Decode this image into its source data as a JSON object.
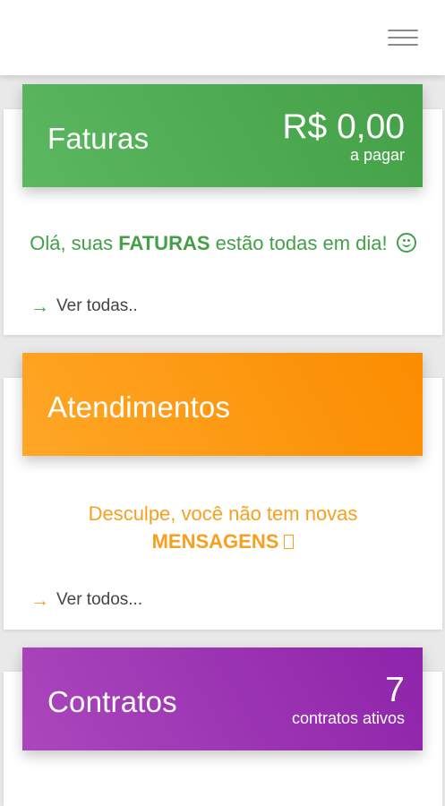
{
  "header": {
    "menu_icon": "hamburger-menu-icon"
  },
  "faturas": {
    "title": "Faturas",
    "amount": "R$ 0,00",
    "amount_label": "a pagar",
    "message_prefix": "Olá, suas ",
    "message_highlight": "FATURAS",
    "message_suffix": " estão todas em dia!",
    "message_icon": "smile-icon",
    "link": "Ver todas..",
    "colors": {
      "header_start": "#5cb860",
      "header_end": "#43a047",
      "text": "#43a047"
    }
  },
  "atendimentos": {
    "title": "Atendimentos",
    "message_line1": "Desculpe, você não tem novas",
    "message_highlight": "MENSAGENS",
    "message_icon": "box-glyph-icon",
    "link": "Ver todos...",
    "colors": {
      "header_start": "#ffa726",
      "header_end": "#fb8c00",
      "text": "#f7a01e"
    }
  },
  "contratos": {
    "title": "Contratos",
    "count": "7",
    "count_label": "contratos ativos",
    "colors": {
      "header_start": "#ab47bc",
      "header_end": "#8e24aa",
      "text": "#8e24aa"
    }
  }
}
